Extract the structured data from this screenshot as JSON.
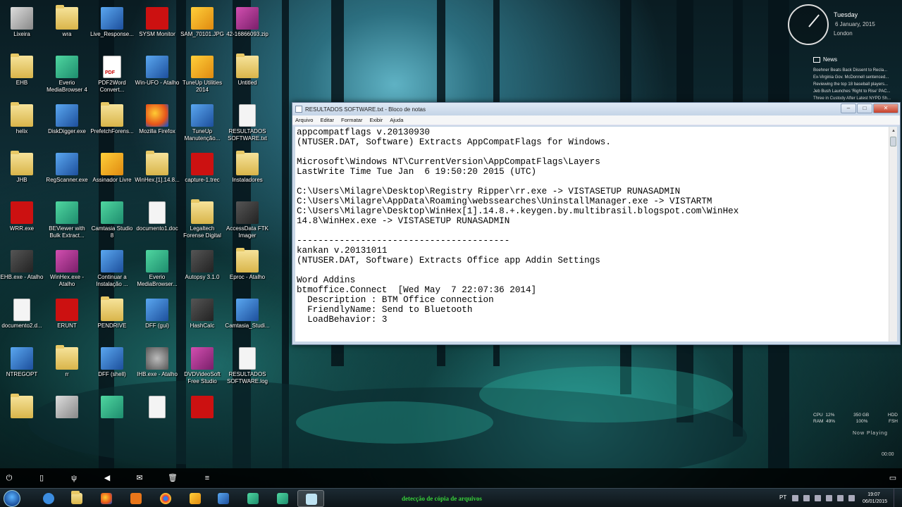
{
  "desktop": {
    "icons": [
      {
        "label": "Lixeira",
        "kind": "recycle"
      },
      {
        "label": "wra",
        "kind": "folder"
      },
      {
        "label": "Live_Response...",
        "kind": "tool"
      },
      {
        "label": "SYSM Monitor",
        "kind": "red-circle"
      },
      {
        "label": "SAM_70101.JPG",
        "kind": "image"
      },
      {
        "label": "42-16866093.zip",
        "kind": "zip"
      },
      {
        "label": "EHB",
        "kind": "folder"
      },
      {
        "label": "Everio MediaBrowser 4",
        "kind": "green"
      },
      {
        "label": "PDF2Word Convert...",
        "kind": "pdf"
      },
      {
        "label": "Win-UFO - Atalho",
        "kind": "blue"
      },
      {
        "label": "TuneUp Utilities 2014",
        "kind": "orange"
      },
      {
        "label": "Untitled",
        "kind": "folder"
      },
      {
        "label": "helix",
        "kind": "folder"
      },
      {
        "label": "DiskDigger.exe",
        "kind": "tool"
      },
      {
        "label": "PrefetchForens...",
        "kind": "folder"
      },
      {
        "label": "Mozilla Firefox",
        "kind": "firefox"
      },
      {
        "label": "TuneUp Manutenção...",
        "kind": "blue"
      },
      {
        "label": "RESULTADOS SOFTWARE.txt",
        "kind": "file"
      },
      {
        "label": "JHB",
        "kind": "folder"
      },
      {
        "label": "RegScanner.exe",
        "kind": "blue"
      },
      {
        "label": "Assinador Livre",
        "kind": "orange"
      },
      {
        "label": "WinHex.[1].14.8...",
        "kind": "folder"
      },
      {
        "label": "capture-1.trec",
        "kind": "red"
      },
      {
        "label": "Instaladores",
        "kind": "folder"
      },
      {
        "label": "WRR.exe",
        "kind": "red"
      },
      {
        "label": "BEViewer with Bulk Extract...",
        "kind": "green"
      },
      {
        "label": "Camtasia Studio 8",
        "kind": "green"
      },
      {
        "label": "documento1.doc",
        "kind": "file"
      },
      {
        "label": "Legaltech Forense Digital",
        "kind": "folder"
      },
      {
        "label": "AccessData FTK Imager",
        "kind": "dark"
      },
      {
        "label": "EHB.exe - Atalho",
        "kind": "dark"
      },
      {
        "label": "WinHex.exe - Atalho",
        "kind": "purple"
      },
      {
        "label": "Continuar a Instalação ...",
        "kind": "blue"
      },
      {
        "label": "Everio MediaBrowser...",
        "kind": "green"
      },
      {
        "label": "Autopsy 3.1.0",
        "kind": "dark"
      },
      {
        "label": "Eproc - Atalho",
        "kind": "folder"
      },
      {
        "label": "documento2.d...",
        "kind": "file"
      },
      {
        "label": "ERUNT",
        "kind": "red"
      },
      {
        "label": "PENDRIVE",
        "kind": "folder"
      },
      {
        "label": "DFF (gui)",
        "kind": "tool"
      },
      {
        "label": "HashCalc",
        "kind": "dark"
      },
      {
        "label": "Camtasia_Studi...",
        "kind": "blue"
      },
      {
        "label": "NTREGOPT",
        "kind": "blue"
      },
      {
        "label": "rr",
        "kind": "folder"
      },
      {
        "label": "DFF (shell)",
        "kind": "tool"
      },
      {
        "label": "IHB.exe - Atalho",
        "kind": "globe"
      },
      {
        "label": "DVDVideoSoft Free Studio",
        "kind": "purple"
      },
      {
        "label": "RESULTADOS SOFTWARE.log",
        "kind": "file"
      },
      {
        "label": "",
        "kind": "folder"
      },
      {
        "label": "",
        "kind": "grey"
      },
      {
        "label": "",
        "kind": "green"
      },
      {
        "label": "",
        "kind": "file"
      },
      {
        "label": "",
        "kind": "red"
      }
    ]
  },
  "clock": {
    "day": "Tuesday",
    "date": "6 January, 2015",
    "city": "London"
  },
  "news": {
    "heading": "News",
    "items": [
      "Boehner Beats Back Dissent to Recla...",
      "Ex-Virginia Gov. McDonnell sentenced...",
      "Reviewing the top 18 baseball players...",
      "Jeb Bush Launches 'Right to Rise' PAC...",
      "Three in Custody After Latest NYPD Sh..."
    ]
  },
  "notepad": {
    "title": "RESULTADOS SOFTWARE.txt - Bloco de notas",
    "menu": [
      "Arquivo",
      "Editar",
      "Formatar",
      "Exibir",
      "Ajuda"
    ],
    "buttons": {
      "minimize": "–",
      "maximize": "□",
      "close": "✕"
    },
    "lines": [
      "appcompatflags v.20130930",
      "(NTUSER.DAT, Software) Extracts AppCompatFlags for Windows.",
      "",
      "Microsoft\\Windows NT\\CurrentVersion\\AppCompatFlags\\Layers",
      "LastWrite Time Tue Jan  6 19:50:20 2015 (UTC)",
      "",
      "C:\\Users\\Milagre\\Desktop\\Registry Ripper\\rr.exe -> VISTASETUP RUNASADMIN",
      "C:\\Users\\Milagre\\AppData\\Roaming\\webssearches\\UninstallManager.exe -> VISTARTM",
      "C:\\Users\\Milagre\\Desktop\\WinHex[1].14.8.+.keygen.by.multibrasil.blogspot.com\\WinHex",
      "14.8\\WinHex.exe -> VISTASETUP RUNASADMIN",
      "",
      "----------------------------------------",
      "kankan v.20131011",
      "(NTUSER.DAT, Software) Extracts Office app Addin Settings",
      "",
      "Word Addins",
      "btmoffice.Connect  [Wed May  7 22:07:36 2014]",
      "  Description : BTM Office connection",
      "  FriendlyName: Send to Bluetooth",
      "  LoadBehavior: 3"
    ]
  },
  "meter": {
    "cpu_label": "CPU",
    "cpu_value": "12%",
    "ram_label": "RAM",
    "ram_value": "49%",
    "disk1": "350 GB",
    "disk1_pct": "100%",
    "disk2": "HDD",
    "disk2_val": "FSH"
  },
  "now_playing": {
    "label": "Now Playing",
    "time": "00:00"
  },
  "taskbar": {
    "task_text": "detecção de cópia de arquivos",
    "lang": "PT",
    "time": "19:07",
    "date": "06/01/2015"
  }
}
